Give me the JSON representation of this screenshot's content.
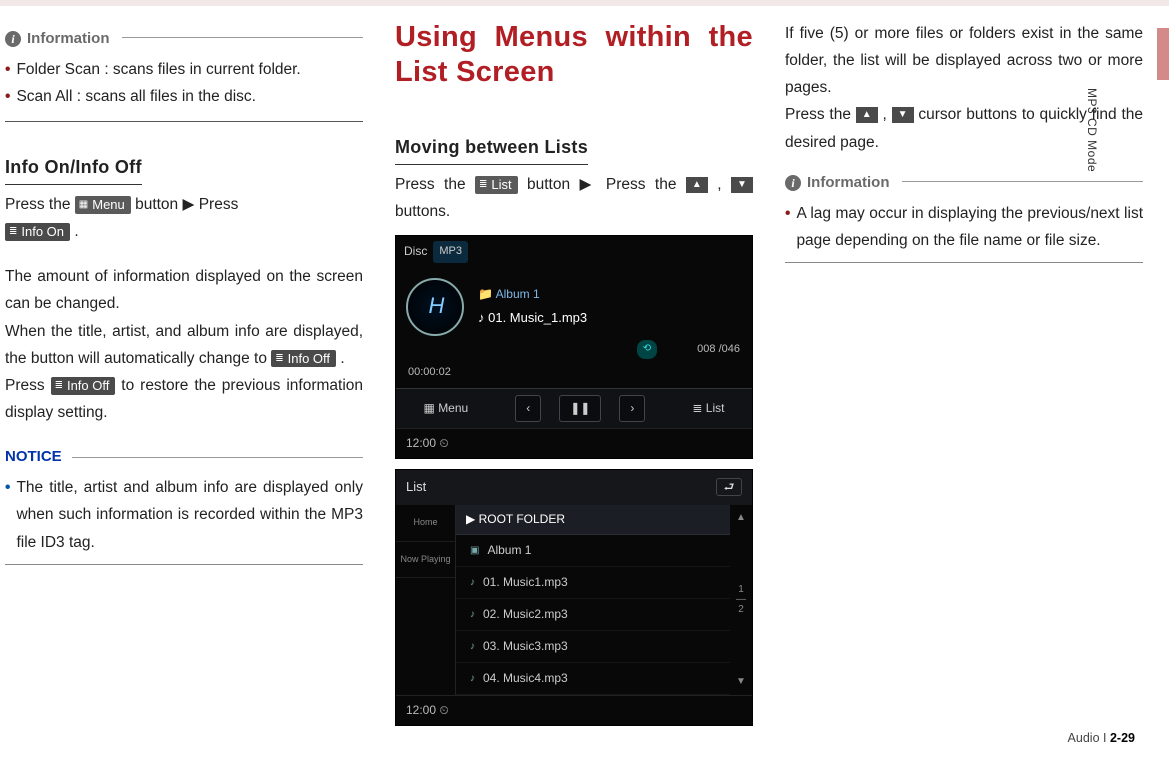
{
  "side_label": "MP3 CD Mode",
  "col1": {
    "info_title": "Information",
    "bul1": "Folder Scan : scans files in current folder.",
    "bul2": "Scan All : scans all files in the disc.",
    "sub": "Info On/Info Off",
    "p1a": "Press the ",
    "chip_menu": "Menu",
    "p1b": " button ▶ Press",
    "chip_info_on": "Info On",
    "p1c": " .",
    "p2": "The amount of information displayed on the screen can be changed.",
    "p3a": "When the title, artist, and album info are displayed, the button will automatically change to ",
    "chip_info_off": "Info Off",
    "p3b": " .",
    "p4a": "Press ",
    "p4b": " to restore the previous information display setting.",
    "notice": "NOTICE",
    "nb1": "The title, artist and album info are displayed only when such information is recorded within the MP3 file ID3 tag."
  },
  "col2": {
    "h": "Using Menus within the List Screen",
    "sub": "Moving between Lists",
    "p1a": "Press the ",
    "chip_list": "List",
    "p1b": " button ▶ Press the ",
    "p1c": " , ",
    "p1d": " buttons.",
    "shot1": {
      "disc": "Disc",
      "mp3": "MP3",
      "album": "Album 1",
      "track": "01. Music_1.mp3",
      "counter": "008 /046",
      "elapsed": "00:00:02",
      "menu": "Menu",
      "list": "List",
      "clock": "12:00"
    },
    "shot2": {
      "title": "List",
      "home": "Home",
      "now": "Now Playing",
      "root": "ROOT FOLDER",
      "i1": "Album 1",
      "i2": "01. Music1.mp3",
      "i3": "02. Music2.mp3",
      "i4": "03. Music3.mp3",
      "i5": "04. Music4.mp3",
      "frac_top": "1",
      "frac_bot": "2",
      "clock": "12:00"
    }
  },
  "col3": {
    "p1": "If five (5) or more files or folders exist in the same folder, the list will be displayed across two or more pages.",
    "p2a": "Press the ",
    "p2b": " , ",
    "p2c": " cursor buttons to quickly find the desired page.",
    "info_title": "Information",
    "bul1": "A lag may occur in displaying the previous/next list page depending on the file name or file size."
  },
  "footer": {
    "section": "Audio",
    "sep": "  I  ",
    "page": "2-29"
  }
}
